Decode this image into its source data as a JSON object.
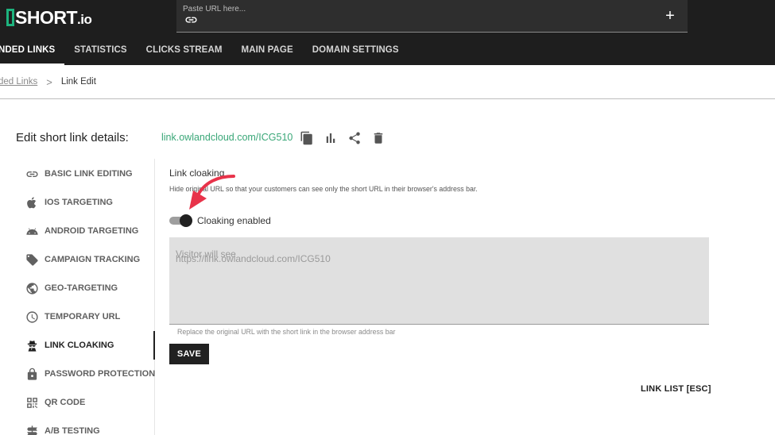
{
  "brand": {
    "logo_text": "SHORT",
    "logo_suffix": ".io"
  },
  "url_input": {
    "placeholder": "Paste URL here..."
  },
  "tabs": [
    {
      "label": "NDED LINKS",
      "active": true
    },
    {
      "label": "STATISTICS",
      "active": false
    },
    {
      "label": "CLICKS STREAM",
      "active": false
    },
    {
      "label": "MAIN PAGE",
      "active": false
    },
    {
      "label": "DOMAIN SETTINGS",
      "active": false
    }
  ],
  "breadcrumb": {
    "parent": "ded Links",
    "separator": ">",
    "current": "Link Edit"
  },
  "header": {
    "title": "Edit short link details:",
    "short_link": "link.owlandcloud.com/ICG510"
  },
  "header_icons": [
    "copy-icon",
    "statistics-icon",
    "share-icon",
    "delete-icon"
  ],
  "sidebar": {
    "items": [
      {
        "label": "BASIC LINK EDITING",
        "icon": "link-icon"
      },
      {
        "label": "IOS TARGETING",
        "icon": "apple-icon"
      },
      {
        "label": "ANDROID TARGETING",
        "icon": "android-icon"
      },
      {
        "label": "CAMPAIGN TRACKING",
        "icon": "tag-icon"
      },
      {
        "label": "GEO-TARGETING",
        "icon": "globe-icon"
      },
      {
        "label": "TEMPORARY URL",
        "icon": "clock-icon"
      },
      {
        "label": "LINK CLOAKING",
        "icon": "spy-icon",
        "active": true
      },
      {
        "label": "PASSWORD PROTECTION",
        "icon": "lock-icon"
      },
      {
        "label": "QR CODE",
        "icon": "qr-code-icon"
      },
      {
        "label": "A/B TESTING",
        "icon": "ab-testing-icon"
      }
    ]
  },
  "cloaking": {
    "title": "Link cloaking",
    "description": "Hide original URL so that your customers can see only the short URL in their browser's address bar.",
    "toggle_label": "Cloaking enabled",
    "toggle_on": true,
    "field_label": "Visitor will see",
    "field_value": "https://link.owlandcloud.com/ICG510",
    "helper": "Replace the original URL with the short link in the browser address bar",
    "save_label": "SAVE"
  },
  "footer": {
    "link_list_label": "LINK LIST [ESC]"
  },
  "colors": {
    "accent_green": "#3aa778",
    "dark": "#1e1e1e",
    "arrow_red": "#e8334a"
  }
}
